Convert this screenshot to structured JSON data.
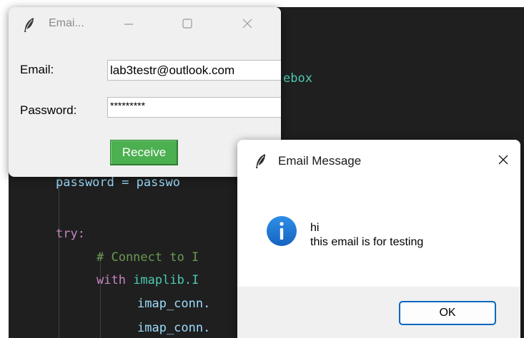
{
  "editor": {
    "lines": [
      {
        "text": "ebox"
      },
      {
        "text": "password = passwo"
      },
      {
        "text": "try:"
      },
      {
        "text": "# Connect to I"
      },
      {
        "text": "with "
      },
      {
        "text": "imaplib.I"
      },
      {
        "text": "imap_conn."
      },
      {
        "text": "imap_conn."
      }
    ]
  },
  "main_window": {
    "title": "Emai...",
    "email_label": "Email:",
    "email_value": "lab3testr@outlook.com",
    "password_label": "Password:",
    "password_value": "*********",
    "receive_label": "Receive",
    "colors": {
      "receive_button": "#4caf50"
    }
  },
  "message_box": {
    "title": "Email Message",
    "line1": "hi",
    "line2": "this email is for testing",
    "ok_label": "OK",
    "icon": "info-icon",
    "colors": {
      "info_icon": "#1976d2",
      "ok_border": "#0067c0"
    }
  }
}
